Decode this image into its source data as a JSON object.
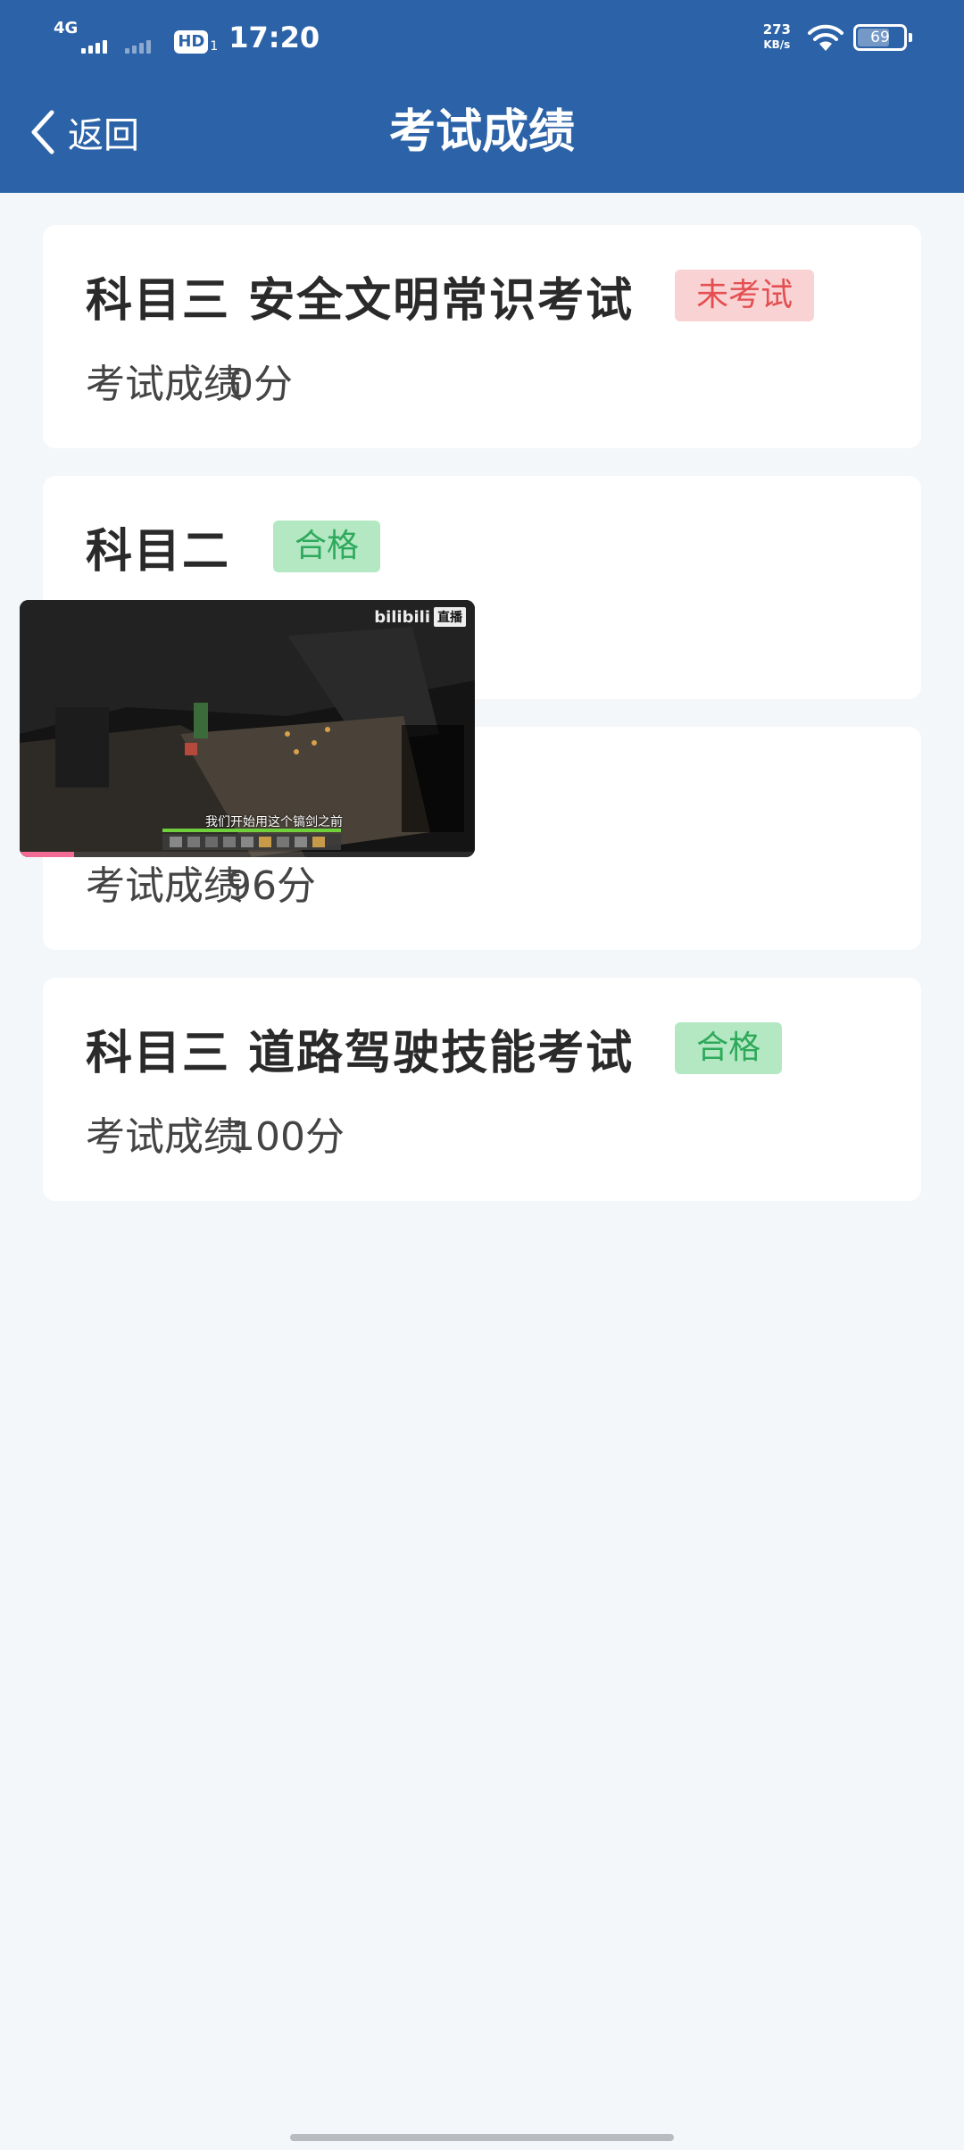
{
  "status_bar": {
    "network_type": "4G",
    "hd_label": "HD",
    "hd_sub": "1",
    "time": "17:20",
    "net_speed_value": "273",
    "net_speed_unit": "KB/s",
    "battery_level": "69"
  },
  "nav": {
    "back_label": "返回",
    "title": "考试成绩"
  },
  "cards": [
    {
      "title": "科目三 安全文明常识考试",
      "status": "未考试",
      "status_type": "fail",
      "score_label": "考试成绩",
      "score_value": "0分"
    },
    {
      "title": "科目二",
      "status": "合格",
      "status_type": "pass",
      "score_label": "",
      "score_value": ""
    },
    {
      "title": "",
      "status": "",
      "status_type": "",
      "score_label": "考试成绩",
      "score_value": "96分"
    },
    {
      "title": "科目三 道路驾驶技能考试",
      "status": "合格",
      "status_type": "pass",
      "score_label": "考试成绩",
      "score_value": "100分"
    }
  ],
  "video": {
    "logo_text": "bilibili",
    "logo_mark": "直播",
    "subtitle": "我们开始用这个镐剑之前",
    "progress": 0.12
  },
  "colors": {
    "header_bg": "#2c63a8",
    "fail_bg": "#f9d3d4",
    "fail_text": "#e44f51",
    "pass_bg": "#b3e8c3",
    "pass_text": "#2ea95b"
  }
}
